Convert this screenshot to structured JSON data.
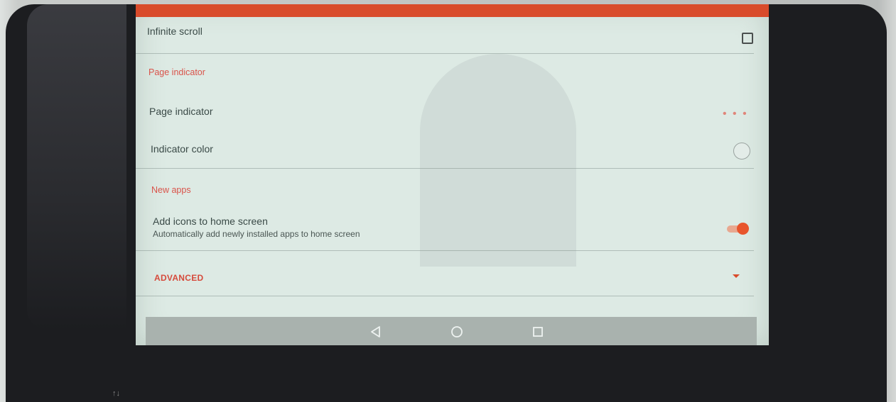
{
  "settings": {
    "infinite_scroll": {
      "title": "Infinite scroll",
      "checked": false
    },
    "page_indicator_section": "Page indicator",
    "page_indicator": {
      "title": "Page indicator",
      "value": "• • •"
    },
    "indicator_color": {
      "title": "Indicator color"
    },
    "new_apps_section": "New apps",
    "add_icons": {
      "title": "Add icons to home screen",
      "summary": "Automatically add newly installed apps to home screen",
      "enabled": true
    },
    "advanced_label": "ADVANCED"
  },
  "device": {
    "bottom_marks": "↑↓"
  },
  "colors": {
    "accent": "#e8552c",
    "section": "#d9534a"
  },
  "navbar": {
    "icons": [
      "back-icon",
      "home-icon",
      "recents-icon"
    ]
  }
}
